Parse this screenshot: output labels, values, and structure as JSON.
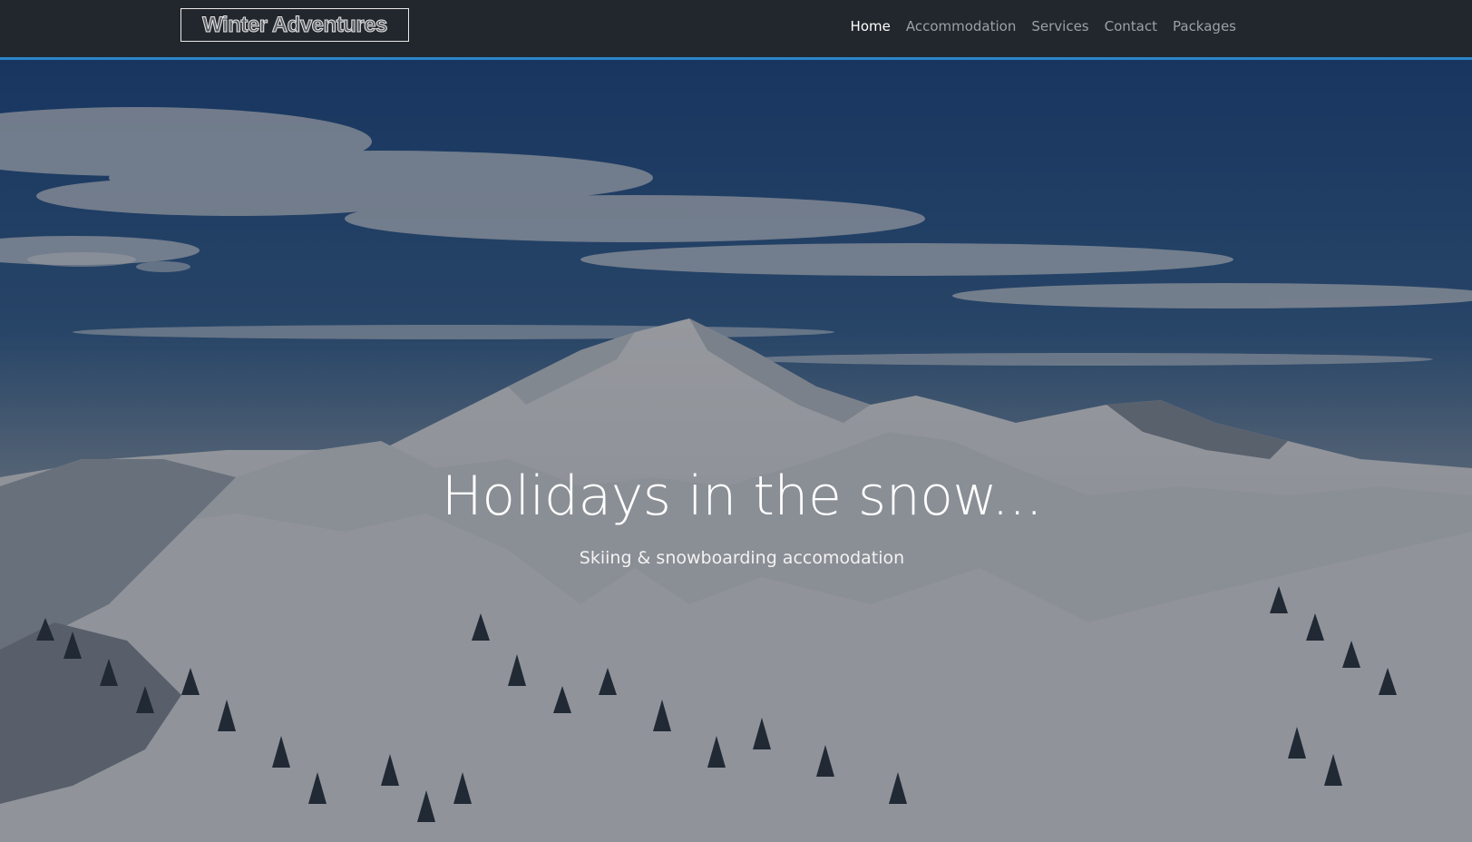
{
  "brand": {
    "logo_text": "Winter Adventures"
  },
  "nav": {
    "items": [
      {
        "label": "Home",
        "active": true
      },
      {
        "label": "Accommodation",
        "active": false
      },
      {
        "label": "Services",
        "active": false
      },
      {
        "label": "Contact",
        "active": false
      },
      {
        "label": "Packages",
        "active": false
      }
    ]
  },
  "hero": {
    "title": "Holidays in the snow...",
    "subtitle": "Skiing & snowboarding accomodation",
    "background_image": "snowy-mountain-peak"
  },
  "colors": {
    "navbar_bg": "#22272d",
    "accent_border": "#2a86c8",
    "nav_link": "#9aa0a6",
    "nav_link_active": "#ffffff"
  }
}
